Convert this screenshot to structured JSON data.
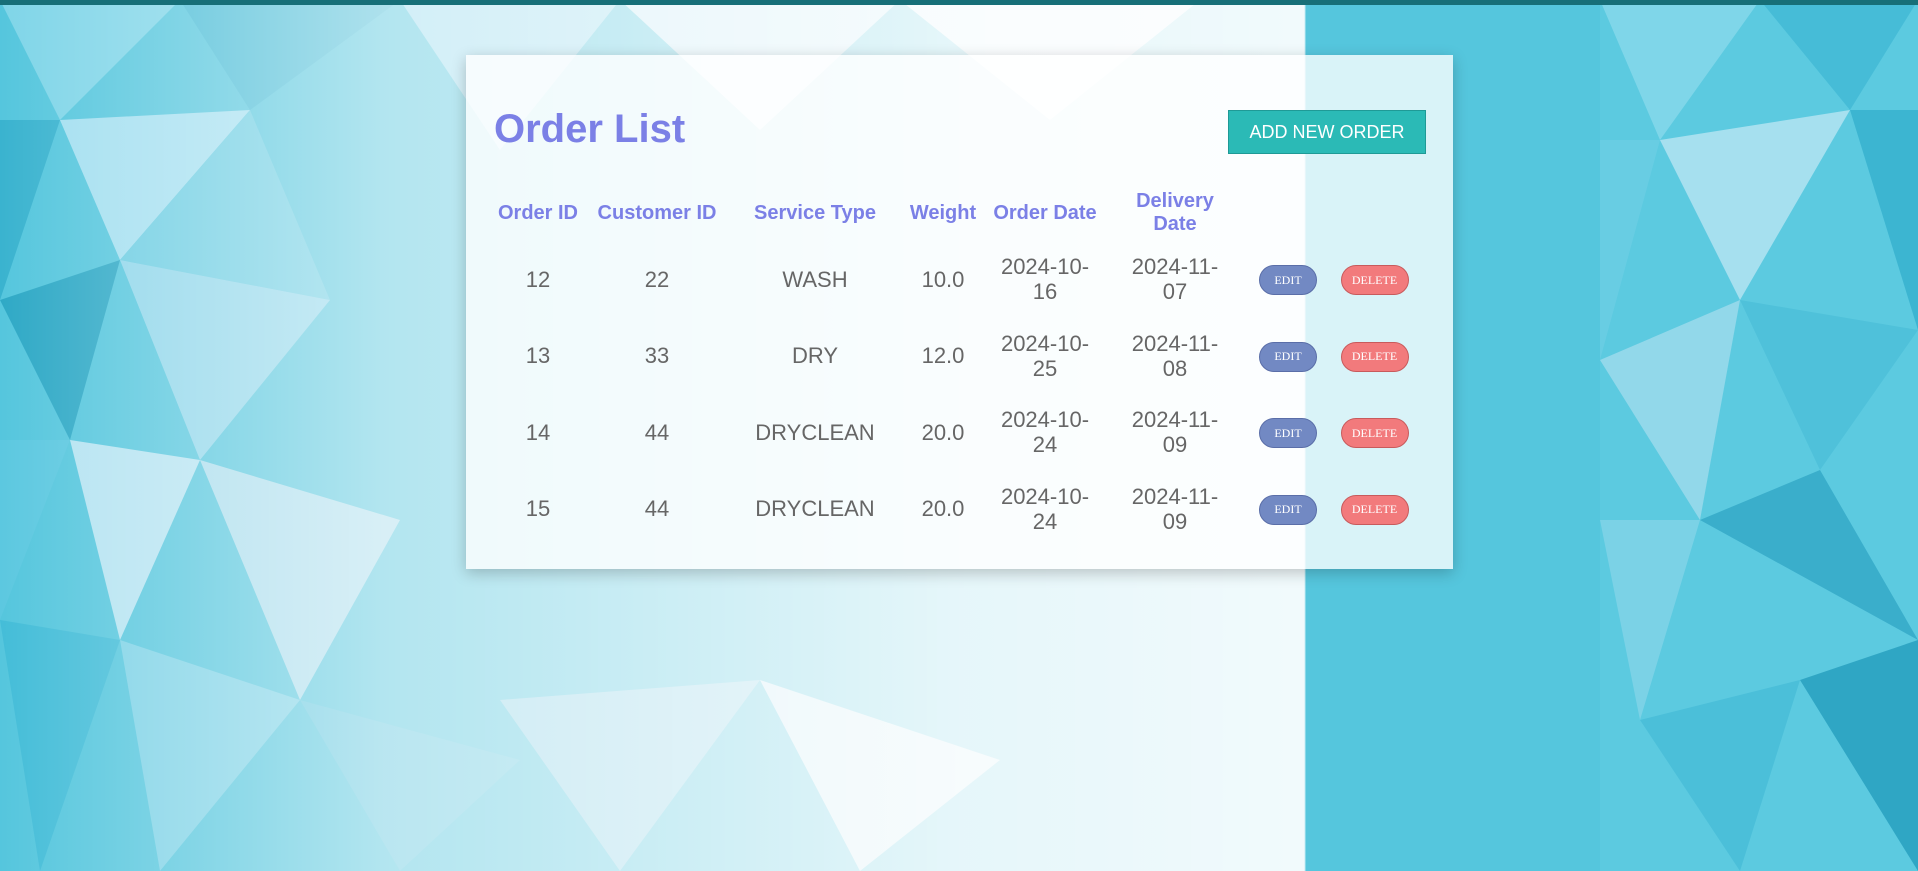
{
  "page": {
    "title": "Order List",
    "add_button_label": "ADD NEW ORDER"
  },
  "table": {
    "headers": [
      "Order ID",
      "Customer ID",
      "Service Type",
      "Weight",
      "Order Date",
      "Delivery Date"
    ],
    "rows": [
      {
        "order_id": "12",
        "customer_id": "22",
        "service_type": "WASH",
        "weight": "10.0",
        "order_date": "2024-10-16",
        "delivery_date": "2024-11-07"
      },
      {
        "order_id": "13",
        "customer_id": "33",
        "service_type": "DRY",
        "weight": "12.0",
        "order_date": "2024-10-25",
        "delivery_date": "2024-11-08"
      },
      {
        "order_id": "14",
        "customer_id": "44",
        "service_type": "DRYCLEAN",
        "weight": "20.0",
        "order_date": "2024-10-24",
        "delivery_date": "2024-11-09"
      },
      {
        "order_id": "15",
        "customer_id": "44",
        "service_type": "DRYCLEAN",
        "weight": "20.0",
        "order_date": "2024-10-24",
        "delivery_date": "2024-11-09"
      }
    ],
    "edit_label": "EDIT",
    "delete_label": "DELETE"
  },
  "colors": {
    "title": "#7b80e6",
    "header_text": "#7b80e6",
    "add_button": "#2bbab6",
    "edit_button": "#7289c3",
    "delete_button": "#f27a7c",
    "cell_text": "#666666",
    "top_strip": "#176f78"
  }
}
